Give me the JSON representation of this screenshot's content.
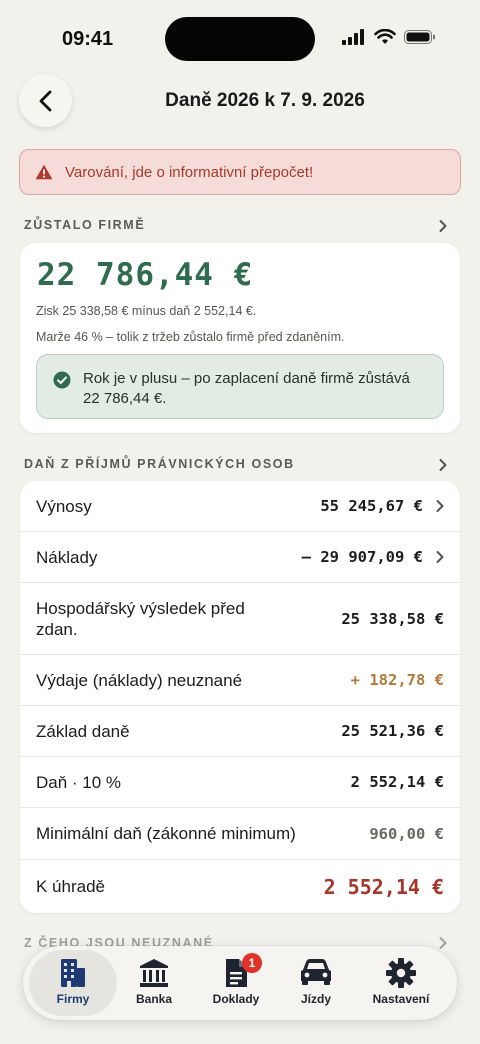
{
  "status": {
    "time": "09:41"
  },
  "header": {
    "title": "Daně 2026 k 7. 9. 2026"
  },
  "warning": {
    "text": "Varování, jde o informativní přepočet!"
  },
  "summary": {
    "section_title": "ZŮSTALO FIRMĚ",
    "amount": "22 786,44 €",
    "profit_line": "Zisk 25 338,58 € mínus daň 2 552,14 €.",
    "margin_line": "Marže 46 % – tolik z tržeb zůstalo firmě před zdaněním.",
    "success_text": "Rok je v plusu – po zaplacení daně firmě zůstává 22 786,44 €."
  },
  "tax": {
    "section_title": "DAŇ Z PŘÍJMŮ PRÁVNICKÝCH OSOB",
    "rows": [
      {
        "label": "Výnosy",
        "value": "55 245,67 €"
      },
      {
        "label": "Náklady",
        "value": "– 29 907,09 €"
      },
      {
        "label": "Hospodářský výsledek před zdan.",
        "value": "25 338,58 €"
      },
      {
        "label": "Výdaje (náklady) neuznané",
        "value": "+ 182,78 €"
      },
      {
        "label": "Základ daně",
        "value": "25 521,36 €"
      },
      {
        "label": "Daň · 10 %",
        "value": "2 552,14 €"
      },
      {
        "label": "Minimální daň (zákonné minimum)",
        "value": "960,00 €"
      },
      {
        "label": "K úhradě",
        "value": "2 552,14 €"
      }
    ]
  },
  "next_section": {
    "title": "Z ČEHO JSOU NEUZNANÉ"
  },
  "tabbar": {
    "tabs": [
      {
        "label": "Firmy",
        "icon": "building-icon"
      },
      {
        "label": "Banka",
        "icon": "bank-icon"
      },
      {
        "label": "Doklady",
        "icon": "document-icon",
        "badge": "1"
      },
      {
        "label": "Jízdy",
        "icon": "car-icon"
      },
      {
        "label": "Nastavení",
        "icon": "gear-icon"
      }
    ]
  },
  "colors": {
    "accent_green": "#2f6b4f",
    "warning_red": "#a83a2a",
    "orange": "#b07a3a",
    "due_red": "#a8352a",
    "tab_active": "#1f3a72"
  }
}
